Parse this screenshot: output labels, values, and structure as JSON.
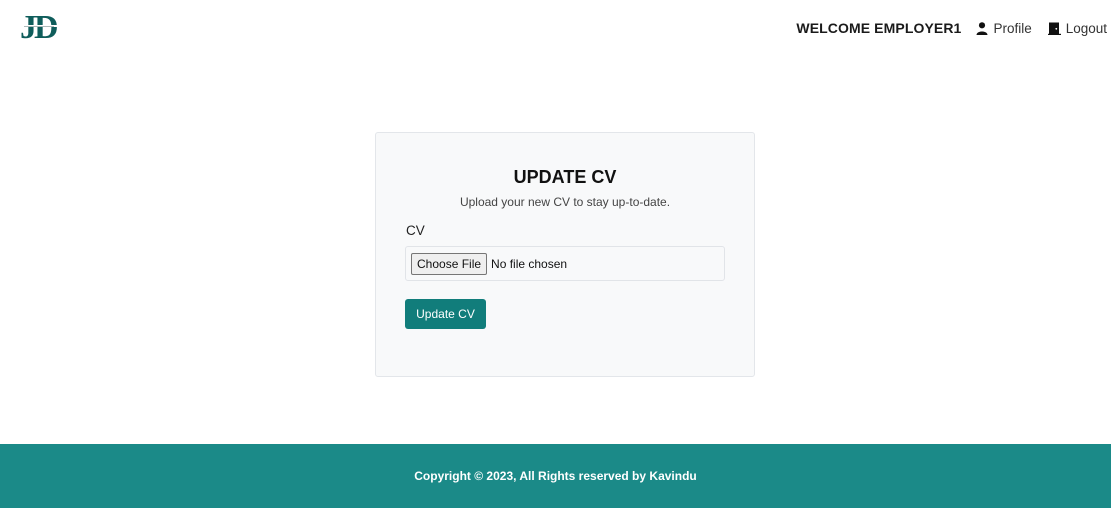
{
  "header": {
    "logo_letters": "JD",
    "welcome": "WELCOME EMPLOYER1",
    "profile_label": "Profile",
    "profile_icon": "user-icon",
    "logout_label": "Logout",
    "logout_icon": "door-icon"
  },
  "card": {
    "title": "UPDATE CV",
    "subtitle": "Upload your new CV to stay up-to-date.",
    "cv_label": "CV",
    "choose_file_label": "Choose File",
    "no_file_text": "No file chosen",
    "submit_label": "Update CV"
  },
  "footer": {
    "copyright": "Copyright © 2023, All Rights reserved by Kavindu"
  },
  "colors": {
    "brand_teal": "#117d7b",
    "footer_teal": "#1b8a88",
    "card_bg": "#f8f9fa"
  }
}
